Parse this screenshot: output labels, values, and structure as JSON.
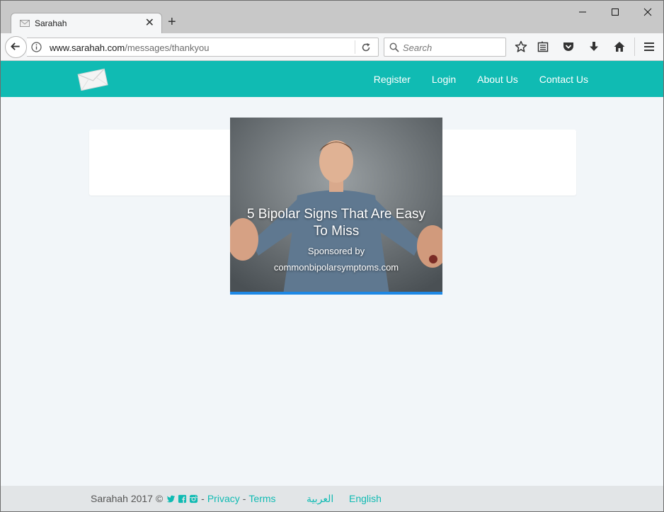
{
  "browser": {
    "tab_title": "Sarahah",
    "new_tab_symbol": "+",
    "url_host": "www.sarahah.com",
    "url_path": "/messages/thankyou",
    "search_placeholder": "Search",
    "icons": [
      "back-icon",
      "info-icon",
      "reload-icon",
      "search-icon",
      "bookmark-star-icon",
      "reader-list-icon",
      "pocket-icon",
      "download-icon",
      "home-icon",
      "menu-icon",
      "close-icon",
      "minimize-icon",
      "maximize-icon"
    ]
  },
  "site": {
    "brand_color": "#10bbb3",
    "nav": {
      "register": "Register",
      "login": "Login",
      "about": "About Us",
      "contact": "Contact Us"
    }
  },
  "ad": {
    "title": "5 Bipolar Signs That Are Easy To Miss",
    "sponsor_label": "Sponsored by",
    "sponsor_domain": "commonbipolarsymptoms.com"
  },
  "footer": {
    "copyright": "Sarahah 2017 ©",
    "separator": "-",
    "privacy": "Privacy",
    "terms": "Terms",
    "lang_arabic": "العربية",
    "lang_english": "English"
  }
}
